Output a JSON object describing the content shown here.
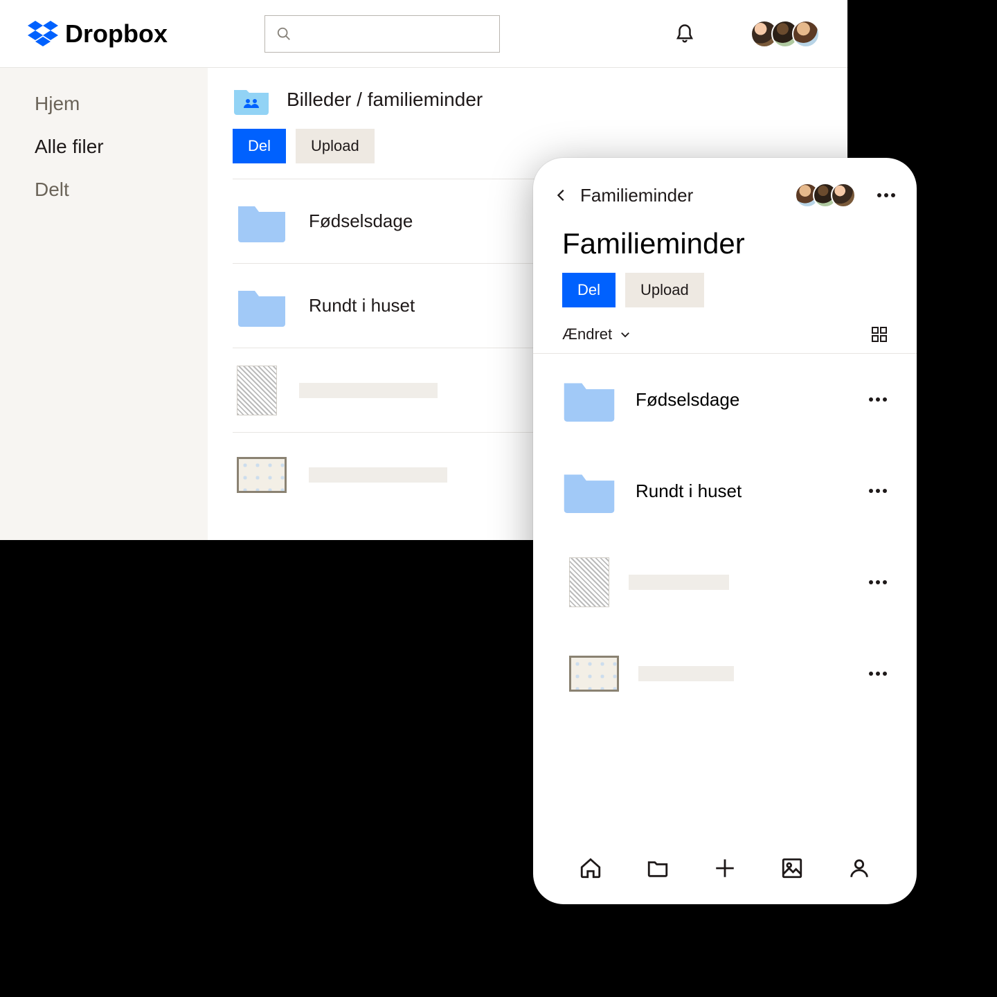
{
  "brand": "Dropbox",
  "topbar": {
    "search_placeholder": ""
  },
  "sidebar": {
    "items": [
      {
        "label": "Hjem",
        "active": false
      },
      {
        "label": "Alle filer",
        "active": true
      },
      {
        "label": "Delt",
        "active": false
      }
    ]
  },
  "desktop": {
    "breadcrumb": "Billeder / familieminder",
    "share_label": "Del",
    "upload_label": "Upload",
    "rows": [
      {
        "type": "folder",
        "label": "Fødselsdage"
      },
      {
        "type": "folder",
        "label": "Rundt i huset"
      },
      {
        "type": "file",
        "thumb": "portrait"
      },
      {
        "type": "file",
        "thumb": "landscape"
      }
    ]
  },
  "mobile": {
    "header_title": "Familieminder",
    "page_title": "Familieminder",
    "share_label": "Del",
    "upload_label": "Upload",
    "sort_label": "Ændret",
    "rows": [
      {
        "type": "folder",
        "label": "Fødselsdage"
      },
      {
        "type": "folder",
        "label": "Rundt i huset"
      },
      {
        "type": "file",
        "thumb": "portrait"
      },
      {
        "type": "file",
        "thumb": "landscape"
      }
    ],
    "tabs": [
      "home",
      "files",
      "add",
      "photos",
      "account"
    ]
  }
}
